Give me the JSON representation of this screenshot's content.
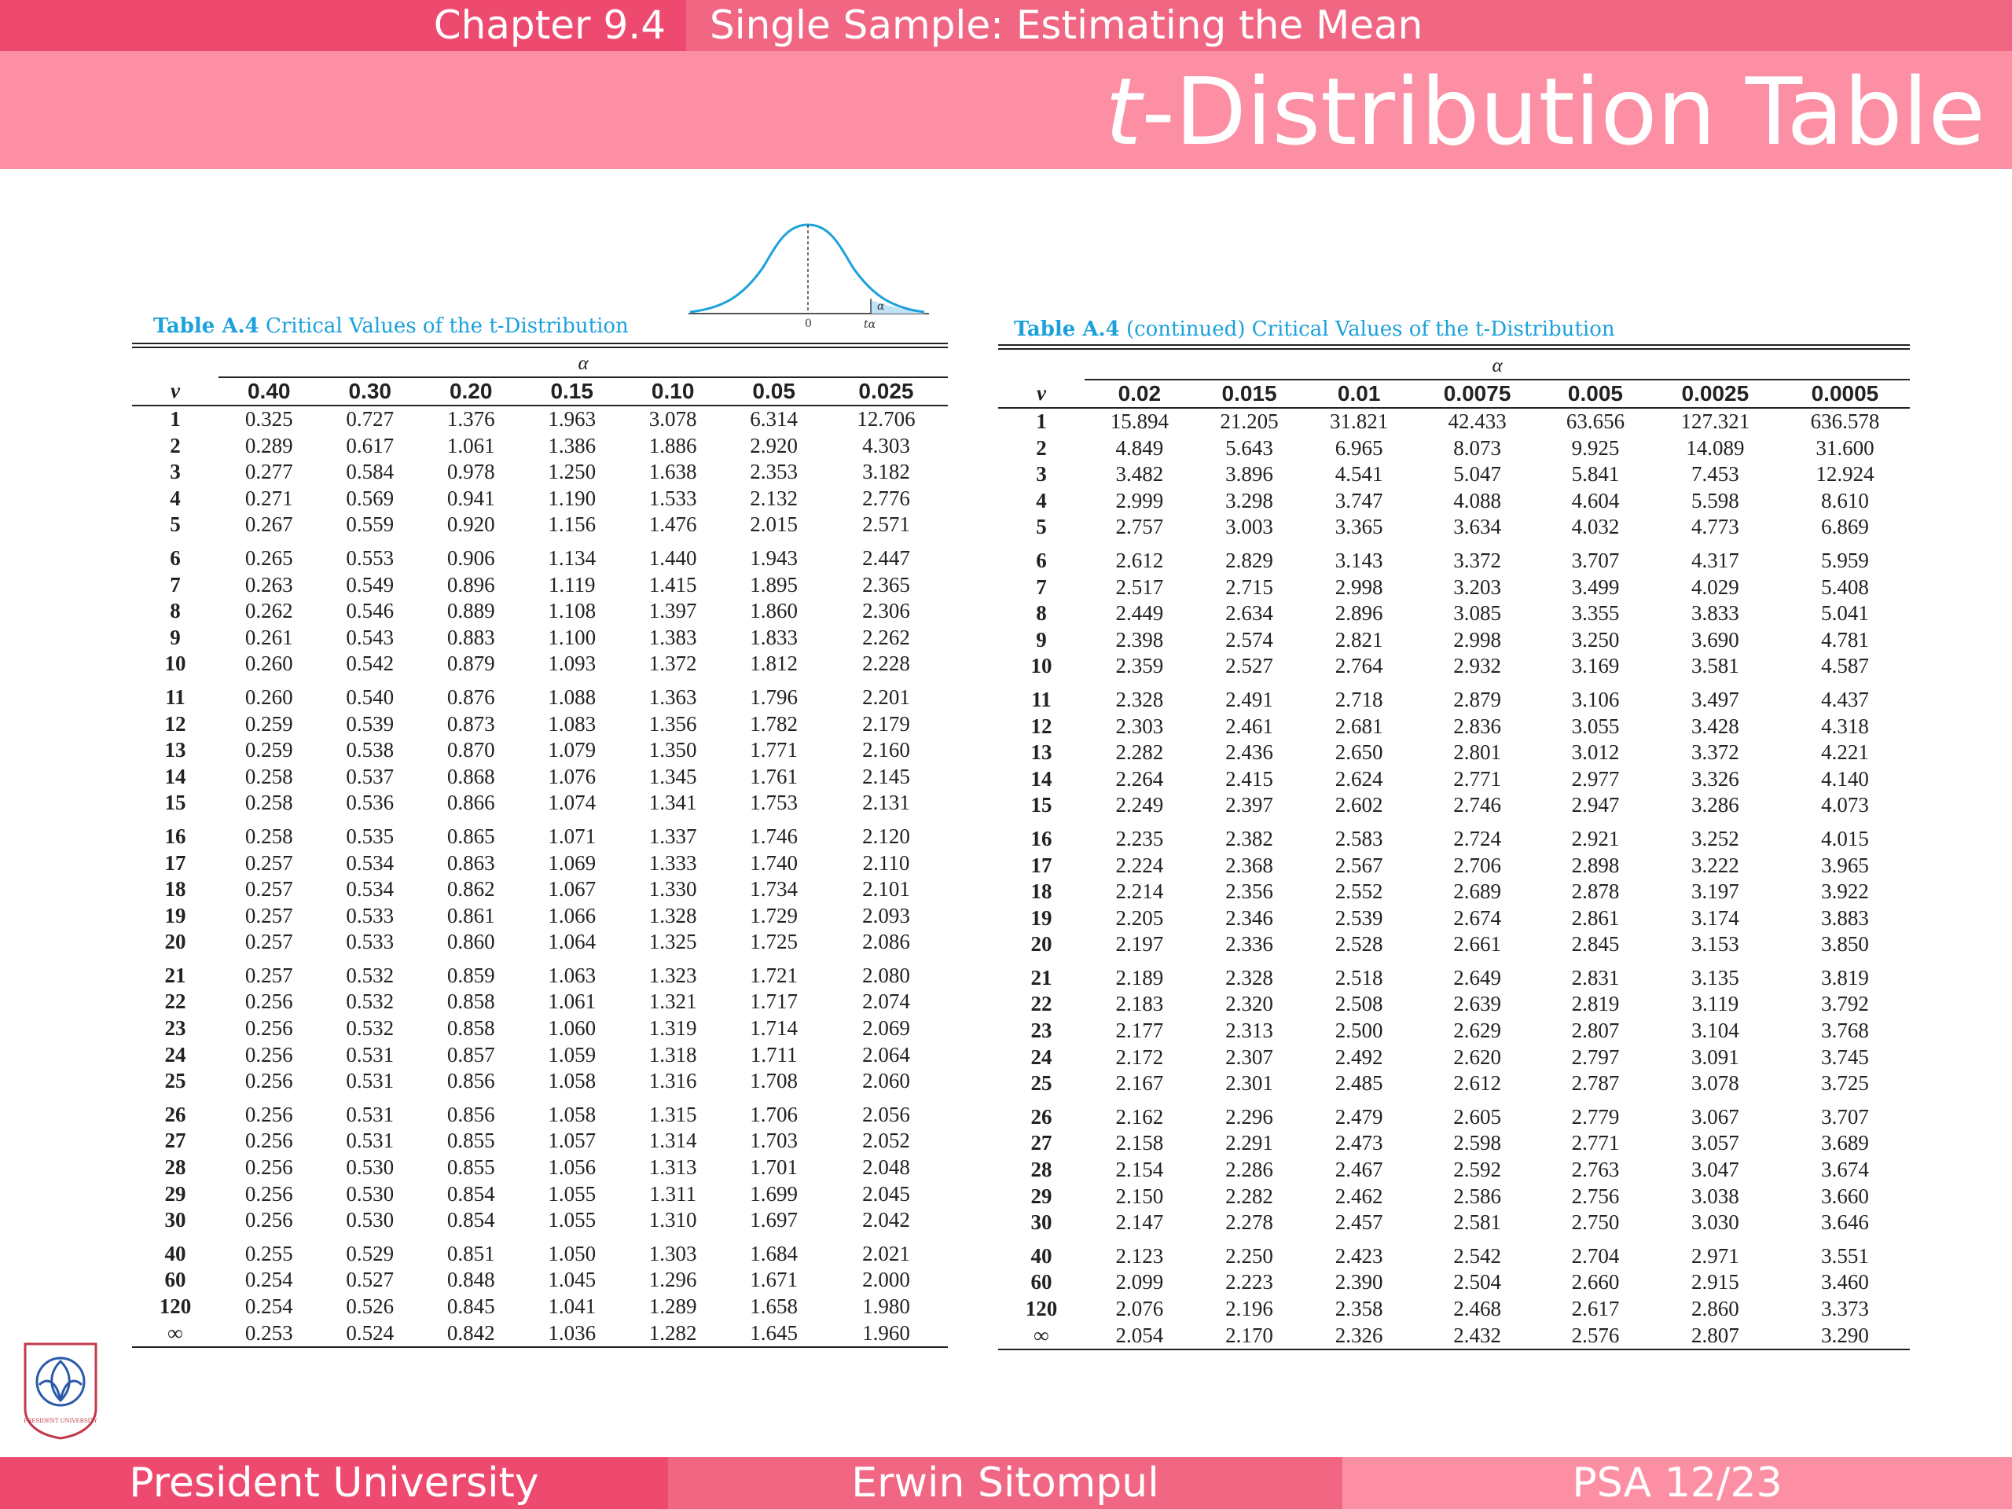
{
  "header": {
    "chapter": "Chapter 9.4",
    "section": "Single Sample: Estimating the Mean",
    "title_var": "t",
    "title_rest": "-Distribution Table"
  },
  "footer": {
    "left": "President University",
    "center": "Erwin Sitompul",
    "right": "PSA 12/23"
  },
  "colors": {
    "chapter_bg": "#ee4a6f",
    "topbar_bg": "#f06683",
    "titlebar_bg": "#fc8fa4",
    "caption": "#1ba1dc",
    "curve": "#1ba1dc"
  },
  "figure": {
    "zero": "0",
    "t_alpha": "tα",
    "alpha": "α"
  },
  "logo_text": "PRESIDENT UNIVERSITY",
  "table1": {
    "caption_bold": "Table A.4",
    "caption_rest": "Critical Values of the t-Distribution",
    "alpha_label": "α",
    "nu_label": "v",
    "columns": [
      "0.40",
      "0.30",
      "0.20",
      "0.15",
      "0.10",
      "0.05",
      "0.025"
    ],
    "rows": [
      [
        "1",
        "0.325",
        "0.727",
        "1.376",
        "1.963",
        "3.078",
        "6.314",
        "12.706"
      ],
      [
        "2",
        "0.289",
        "0.617",
        "1.061",
        "1.386",
        "1.886",
        "2.920",
        "4.303"
      ],
      [
        "3",
        "0.277",
        "0.584",
        "0.978",
        "1.250",
        "1.638",
        "2.353",
        "3.182"
      ],
      [
        "4",
        "0.271",
        "0.569",
        "0.941",
        "1.190",
        "1.533",
        "2.132",
        "2.776"
      ],
      [
        "5",
        "0.267",
        "0.559",
        "0.920",
        "1.156",
        "1.476",
        "2.015",
        "2.571"
      ],
      [
        "6",
        "0.265",
        "0.553",
        "0.906",
        "1.134",
        "1.440",
        "1.943",
        "2.447"
      ],
      [
        "7",
        "0.263",
        "0.549",
        "0.896",
        "1.119",
        "1.415",
        "1.895",
        "2.365"
      ],
      [
        "8",
        "0.262",
        "0.546",
        "0.889",
        "1.108",
        "1.397",
        "1.860",
        "2.306"
      ],
      [
        "9",
        "0.261",
        "0.543",
        "0.883",
        "1.100",
        "1.383",
        "1.833",
        "2.262"
      ],
      [
        "10",
        "0.260",
        "0.542",
        "0.879",
        "1.093",
        "1.372",
        "1.812",
        "2.228"
      ],
      [
        "11",
        "0.260",
        "0.540",
        "0.876",
        "1.088",
        "1.363",
        "1.796",
        "2.201"
      ],
      [
        "12",
        "0.259",
        "0.539",
        "0.873",
        "1.083",
        "1.356",
        "1.782",
        "2.179"
      ],
      [
        "13",
        "0.259",
        "0.538",
        "0.870",
        "1.079",
        "1.350",
        "1.771",
        "2.160"
      ],
      [
        "14",
        "0.258",
        "0.537",
        "0.868",
        "1.076",
        "1.345",
        "1.761",
        "2.145"
      ],
      [
        "15",
        "0.258",
        "0.536",
        "0.866",
        "1.074",
        "1.341",
        "1.753",
        "2.131"
      ],
      [
        "16",
        "0.258",
        "0.535",
        "0.865",
        "1.071",
        "1.337",
        "1.746",
        "2.120"
      ],
      [
        "17",
        "0.257",
        "0.534",
        "0.863",
        "1.069",
        "1.333",
        "1.740",
        "2.110"
      ],
      [
        "18",
        "0.257",
        "0.534",
        "0.862",
        "1.067",
        "1.330",
        "1.734",
        "2.101"
      ],
      [
        "19",
        "0.257",
        "0.533",
        "0.861",
        "1.066",
        "1.328",
        "1.729",
        "2.093"
      ],
      [
        "20",
        "0.257",
        "0.533",
        "0.860",
        "1.064",
        "1.325",
        "1.725",
        "2.086"
      ],
      [
        "21",
        "0.257",
        "0.532",
        "0.859",
        "1.063",
        "1.323",
        "1.721",
        "2.080"
      ],
      [
        "22",
        "0.256",
        "0.532",
        "0.858",
        "1.061",
        "1.321",
        "1.717",
        "2.074"
      ],
      [
        "23",
        "0.256",
        "0.532",
        "0.858",
        "1.060",
        "1.319",
        "1.714",
        "2.069"
      ],
      [
        "24",
        "0.256",
        "0.531",
        "0.857",
        "1.059",
        "1.318",
        "1.711",
        "2.064"
      ],
      [
        "25",
        "0.256",
        "0.531",
        "0.856",
        "1.058",
        "1.316",
        "1.708",
        "2.060"
      ],
      [
        "26",
        "0.256",
        "0.531",
        "0.856",
        "1.058",
        "1.315",
        "1.706",
        "2.056"
      ],
      [
        "27",
        "0.256",
        "0.531",
        "0.855",
        "1.057",
        "1.314",
        "1.703",
        "2.052"
      ],
      [
        "28",
        "0.256",
        "0.530",
        "0.855",
        "1.056",
        "1.313",
        "1.701",
        "2.048"
      ],
      [
        "29",
        "0.256",
        "0.530",
        "0.854",
        "1.055",
        "1.311",
        "1.699",
        "2.045"
      ],
      [
        "30",
        "0.256",
        "0.530",
        "0.854",
        "1.055",
        "1.310",
        "1.697",
        "2.042"
      ],
      [
        "40",
        "0.255",
        "0.529",
        "0.851",
        "1.050",
        "1.303",
        "1.684",
        "2.021"
      ],
      [
        "60",
        "0.254",
        "0.527",
        "0.848",
        "1.045",
        "1.296",
        "1.671",
        "2.000"
      ],
      [
        "120",
        "0.254",
        "0.526",
        "0.845",
        "1.041",
        "1.289",
        "1.658",
        "1.980"
      ],
      [
        "∞",
        "0.253",
        "0.524",
        "0.842",
        "1.036",
        "1.282",
        "1.645",
        "1.960"
      ]
    ]
  },
  "table2": {
    "caption_bold": "Table A.4",
    "caption_rest": "(continued) Critical Values of the t-Distribution",
    "alpha_label": "α",
    "nu_label": "v",
    "columns": [
      "0.02",
      "0.015",
      "0.01",
      "0.0075",
      "0.005",
      "0.0025",
      "0.0005"
    ],
    "rows": [
      [
        "1",
        "15.894",
        "21.205",
        "31.821",
        "42.433",
        "63.656",
        "127.321",
        "636.578"
      ],
      [
        "2",
        "4.849",
        "5.643",
        "6.965",
        "8.073",
        "9.925",
        "14.089",
        "31.600"
      ],
      [
        "3",
        "3.482",
        "3.896",
        "4.541",
        "5.047",
        "5.841",
        "7.453",
        "12.924"
      ],
      [
        "4",
        "2.999",
        "3.298",
        "3.747",
        "4.088",
        "4.604",
        "5.598",
        "8.610"
      ],
      [
        "5",
        "2.757",
        "3.003",
        "3.365",
        "3.634",
        "4.032",
        "4.773",
        "6.869"
      ],
      [
        "6",
        "2.612",
        "2.829",
        "3.143",
        "3.372",
        "3.707",
        "4.317",
        "5.959"
      ],
      [
        "7",
        "2.517",
        "2.715",
        "2.998",
        "3.203",
        "3.499",
        "4.029",
        "5.408"
      ],
      [
        "8",
        "2.449",
        "2.634",
        "2.896",
        "3.085",
        "3.355",
        "3.833",
        "5.041"
      ],
      [
        "9",
        "2.398",
        "2.574",
        "2.821",
        "2.998",
        "3.250",
        "3.690",
        "4.781"
      ],
      [
        "10",
        "2.359",
        "2.527",
        "2.764",
        "2.932",
        "3.169",
        "3.581",
        "4.587"
      ],
      [
        "11",
        "2.328",
        "2.491",
        "2.718",
        "2.879",
        "3.106",
        "3.497",
        "4.437"
      ],
      [
        "12",
        "2.303",
        "2.461",
        "2.681",
        "2.836",
        "3.055",
        "3.428",
        "4.318"
      ],
      [
        "13",
        "2.282",
        "2.436",
        "2.650",
        "2.801",
        "3.012",
        "3.372",
        "4.221"
      ],
      [
        "14",
        "2.264",
        "2.415",
        "2.624",
        "2.771",
        "2.977",
        "3.326",
        "4.140"
      ],
      [
        "15",
        "2.249",
        "2.397",
        "2.602",
        "2.746",
        "2.947",
        "3.286",
        "4.073"
      ],
      [
        "16",
        "2.235",
        "2.382",
        "2.583",
        "2.724",
        "2.921",
        "3.252",
        "4.015"
      ],
      [
        "17",
        "2.224",
        "2.368",
        "2.567",
        "2.706",
        "2.898",
        "3.222",
        "3.965"
      ],
      [
        "18",
        "2.214",
        "2.356",
        "2.552",
        "2.689",
        "2.878",
        "3.197",
        "3.922"
      ],
      [
        "19",
        "2.205",
        "2.346",
        "2.539",
        "2.674",
        "2.861",
        "3.174",
        "3.883"
      ],
      [
        "20",
        "2.197",
        "2.336",
        "2.528",
        "2.661",
        "2.845",
        "3.153",
        "3.850"
      ],
      [
        "21",
        "2.189",
        "2.328",
        "2.518",
        "2.649",
        "2.831",
        "3.135",
        "3.819"
      ],
      [
        "22",
        "2.183",
        "2.320",
        "2.508",
        "2.639",
        "2.819",
        "3.119",
        "3.792"
      ],
      [
        "23",
        "2.177",
        "2.313",
        "2.500",
        "2.629",
        "2.807",
        "3.104",
        "3.768"
      ],
      [
        "24",
        "2.172",
        "2.307",
        "2.492",
        "2.620",
        "2.797",
        "3.091",
        "3.745"
      ],
      [
        "25",
        "2.167",
        "2.301",
        "2.485",
        "2.612",
        "2.787",
        "3.078",
        "3.725"
      ],
      [
        "26",
        "2.162",
        "2.296",
        "2.479",
        "2.605",
        "2.779",
        "3.067",
        "3.707"
      ],
      [
        "27",
        "2.158",
        "2.291",
        "2.473",
        "2.598",
        "2.771",
        "3.057",
        "3.689"
      ],
      [
        "28",
        "2.154",
        "2.286",
        "2.467",
        "2.592",
        "2.763",
        "3.047",
        "3.674"
      ],
      [
        "29",
        "2.150",
        "2.282",
        "2.462",
        "2.586",
        "2.756",
        "3.038",
        "3.660"
      ],
      [
        "30",
        "2.147",
        "2.278",
        "2.457",
        "2.581",
        "2.750",
        "3.030",
        "3.646"
      ],
      [
        "40",
        "2.123",
        "2.250",
        "2.423",
        "2.542",
        "2.704",
        "2.971",
        "3.551"
      ],
      [
        "60",
        "2.099",
        "2.223",
        "2.390",
        "2.504",
        "2.660",
        "2.915",
        "3.460"
      ],
      [
        "120",
        "2.076",
        "2.196",
        "2.358",
        "2.468",
        "2.617",
        "2.860",
        "3.373"
      ],
      [
        "∞",
        "2.054",
        "2.170",
        "2.326",
        "2.432",
        "2.576",
        "2.807",
        "3.290"
      ]
    ]
  }
}
